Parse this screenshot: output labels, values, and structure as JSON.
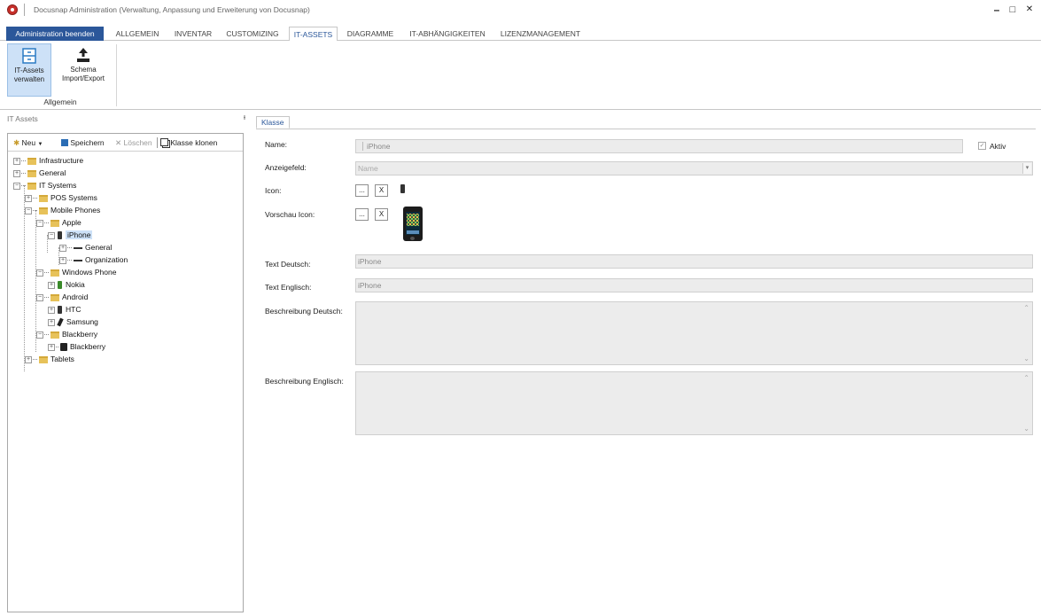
{
  "window": {
    "title": "Docusnap Administration (Verwaltung, Anpassung und Erweiterung von Docusnap)",
    "minimize": "–",
    "maximize": "□",
    "close": "✕"
  },
  "tabs": {
    "exit": "Administration beenden",
    "items": [
      "ALLGEMEIN",
      "INVENTAR",
      "CUSTOMIZING",
      "IT-ASSETS",
      "DIAGRAMME",
      "IT-ABHÄNGIGKEITEN",
      "LIZENZMANAGEMENT"
    ],
    "active": "IT-ASSETS"
  },
  "ribbon": {
    "btn1_line1": "IT-Assets",
    "btn1_line2": "verwalten",
    "btn2_line1": "Schema",
    "btn2_line2": "Import/Export",
    "group": "Allgemein"
  },
  "left_panel": {
    "title": "IT Assets",
    "pin": "ᵻ",
    "toolbar": {
      "new": "Neu",
      "save": "Speichern",
      "delete": "Löschen",
      "clone": "Klasse klonen"
    },
    "tree": {
      "infrastructure": "Infrastructure",
      "general": "General",
      "it_systems": "IT Systems",
      "pos_systems": "POS Systems",
      "mobile_phones": "Mobile Phones",
      "apple": "Apple",
      "iphone": "iPhone",
      "iphone_general": "General",
      "iphone_organization": "Organization",
      "windows_phone": "Windows Phone",
      "nokia": "Nokia",
      "android": "Android",
      "htc": "HTC",
      "samsung": "Samsung",
      "blackberry_folder": "Blackberry",
      "blackberry": "Blackberry",
      "tablets": "Tablets"
    }
  },
  "form": {
    "tab": "Klasse",
    "name_label": "Name:",
    "name_value": "iPhone",
    "active_label": "Aktiv",
    "active_checked": true,
    "display_label": "Anzeigefeld:",
    "display_value": "Name",
    "icon_label": "Icon:",
    "preview_label": "Vorschau Icon:",
    "browse": "...",
    "clear": "X",
    "text_de_label": "Text Deutsch:",
    "text_de_value": "iPhone",
    "text_en_label": "Text Englisch:",
    "text_en_value": "iPhone",
    "desc_de_label": "Beschreibung Deutsch:",
    "desc_en_label": "Beschreibung Englisch:"
  },
  "colors": {
    "accent": "#2b579a",
    "selection": "#cde1f7",
    "folder": "#e7c25a"
  }
}
